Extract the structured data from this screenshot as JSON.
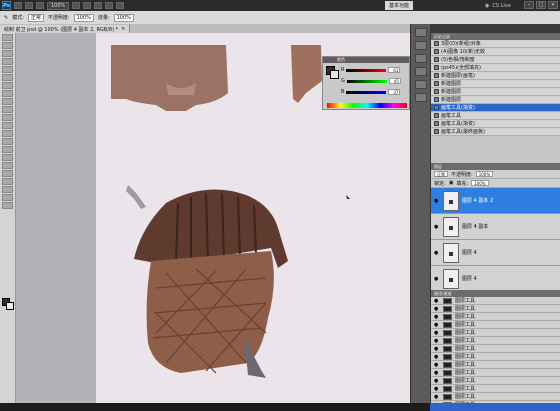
{
  "menubar": {
    "app_logo": "Ps",
    "zoom": "100%",
    "workspace_button": "基本功能",
    "cslive": "CS Live"
  },
  "options": {
    "tool": "模式:",
    "mode": "正常",
    "opacity_label": "不透明度:",
    "opacity": "100%",
    "flow_label": "流量:",
    "flow": "100%"
  },
  "doctab": {
    "title": "绘制 前卫 psd @ 100% (图层 4 副本 2, RGB/8) *",
    "close": "×"
  },
  "colorpanel": {
    "title": "颜色",
    "r": "R",
    "g": "G",
    "b": "B",
    "r_val": "61",
    "g_val": "45",
    "b_val": "37"
  },
  "history": {
    "title": "历史记录",
    "items": [
      "3层(D)(新组)对象",
      "(4)图像 10(新)无效",
      "(5)色相/饱和度",
      "(ps45)(全部填充)",
      "新建图层(画笔)",
      "新建图层",
      "新建图层",
      "新建图层",
      "画笔工具(渐变)",
      "画笔工具",
      "画笔工具(渐变)",
      "画笔工具(最终画板)"
    ],
    "active_index": 8
  },
  "layers": {
    "title": "图层",
    "blend": "正常",
    "opacity_label": "不透明度:",
    "opacity": "100%",
    "lock_label": "锁定:",
    "fill_label": "填充:",
    "fill": "100%",
    "items": [
      {
        "name": "图层 4 副本 2"
      },
      {
        "name": "图层 4 副本"
      },
      {
        "name": "图层 4"
      },
      {
        "name": "图层 4"
      }
    ],
    "active_index": 0
  },
  "sublayers": {
    "title": "路径/通道",
    "items": [
      "图层工具",
      "图层工具",
      "图层工具",
      "图层工具",
      "图层工具",
      "图层工具",
      "图层工具",
      "图层工具",
      "图层工具",
      "图层工具",
      "图层工具",
      "图层工具",
      "图层工具",
      "图层工具",
      "图层工具"
    ],
    "active_index": 14
  }
}
